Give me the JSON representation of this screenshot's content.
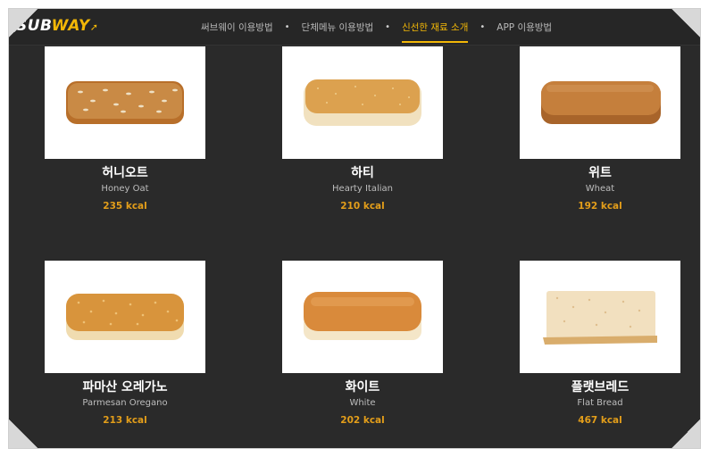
{
  "header": {
    "logo": {
      "part1": "SUB",
      "part2": "WAY"
    },
    "nav": [
      {
        "label": "써브웨이 이용방법",
        "active": false
      },
      {
        "label": "단체메뉴 이용방법",
        "active": false
      },
      {
        "label": "신선한 재료 소개",
        "active": true
      },
      {
        "label": "APP 이용방법",
        "active": false
      }
    ],
    "separator": "•"
  },
  "breads": [
    {
      "ko": "허니오트",
      "en": "Honey Oat",
      "kcal": "235 kcal",
      "icon": "honey-oat-bread-icon"
    },
    {
      "ko": "하티",
      "en": "Hearty Italian",
      "kcal": "210 kcal",
      "icon": "hearty-italian-bread-icon"
    },
    {
      "ko": "위트",
      "en": "Wheat",
      "kcal": "192 kcal",
      "icon": "wheat-bread-icon"
    },
    {
      "ko": "파마산 오레가노",
      "en": "Parmesan Oregano",
      "kcal": "213 kcal",
      "icon": "parmesan-oregano-bread-icon"
    },
    {
      "ko": "화이트",
      "en": "White",
      "kcal": "202 kcal",
      "icon": "white-bread-icon"
    },
    {
      "ko": "플랫브레드",
      "en": "Flat Bread",
      "kcal": "467 kcal",
      "icon": "flat-bread-icon"
    }
  ],
  "colors": {
    "background": "#2a2a2a",
    "accent": "#f2b707",
    "kcal": "#e39e1a"
  }
}
